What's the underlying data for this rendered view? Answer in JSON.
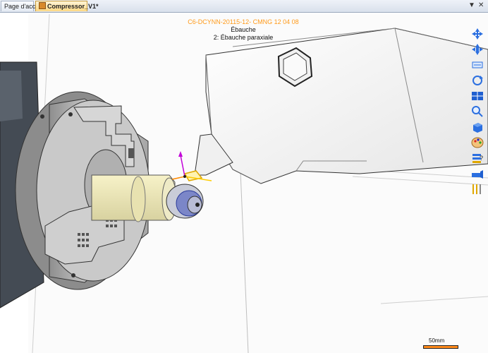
{
  "tabs": {
    "home_label": "Page d'accueil",
    "active_label": "Compressor_V1*"
  },
  "tab_controls": {
    "menu_glyph": "▼",
    "close_glyph": "✕"
  },
  "operation": {
    "program_label": "C6-DCYNN-20115-12- CMNG 12 04 08",
    "step_label": "Ébauche",
    "sub_label": "2: Ébauche paraxiale"
  },
  "toolbar": {
    "icons": [
      "pan-icon",
      "pan-icon",
      "zoom-window-icon",
      "rotate-icon",
      "views-icon",
      "zoom-icon",
      "box-view-icon",
      "color-palette-icon",
      "help-icon",
      "tool-holder-icon",
      "toolpath-icon"
    ]
  },
  "scale": {
    "label": "50mm"
  },
  "colors": {
    "accent_orange": "#ff9a1a",
    "chuck_gray": "#b9b9b9",
    "tool_blue": "#4a7cd8"
  }
}
